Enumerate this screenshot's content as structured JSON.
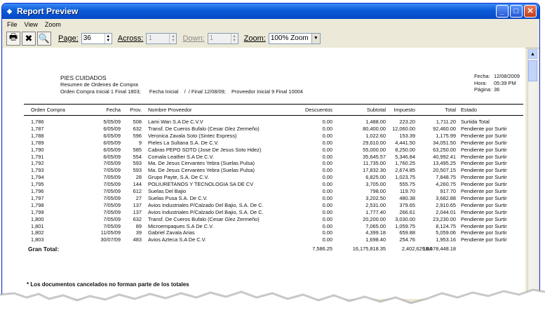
{
  "window": {
    "title": "Report Preview"
  },
  "menu": [
    "File",
    "View",
    "Zoom"
  ],
  "toolbar": {
    "page_label": "Page:",
    "page_value": "36",
    "across_label": "Across:",
    "across_value": "1",
    "down_label": "Down:",
    "down_value": "1",
    "zoom_label": "Zoom:",
    "zoom_value": "100% Zoom"
  },
  "report": {
    "company": "PIES CUIDADOS",
    "subtitle": "Resumen de Ordenes de Compra",
    "filters": "Orden Compra Inicial 1 Final 1803;      Fecha Inicial    /  / Final 12/08/09;    Proveedor Inicial 9 Final 10004",
    "meta": {
      "fecha_label": "Fecha:",
      "fecha": "12/08/2009",
      "hora_label": "Hora:",
      "hora": "05:39 PM",
      "pagina_label": "Página:",
      "pagina": "36"
    },
    "columns": [
      "Orden Compra",
      "Fecha",
      "Prov.",
      "Nombre Proveedor",
      "Descuentos",
      "Subtotal",
      "Impuesto",
      "Total",
      "Estado"
    ],
    "rows": [
      [
        "1,786",
        "5/05/09",
        "508",
        "Lami Wan S.A De C.V.V",
        "0.00",
        "1,488.00",
        "223.20",
        "1,711.20",
        "Surtida Total"
      ],
      [
        "1,787",
        "6/05/09",
        "632",
        "Transf. De Cueros Bufalo (Cesar Glez Zermeño)",
        "0.00",
        "80,400.00",
        "12,060.00",
        "92,460.00",
        "Pendiente por Surtir"
      ],
      [
        "1,788",
        "6/05/09",
        "596",
        "Veronica Zavala Soto  (Sintec Express)",
        "0.00",
        "1,022.60",
        "153.39",
        "1,175.99",
        "Pendiente por Surtir"
      ],
      [
        "1,789",
        "6/05/09",
        "9",
        "Pieles La Sultana S.A. De C.V.",
        "0.00",
        "29,610.00",
        "4,441.50",
        "34,051.50",
        "Pendiente por Surtir"
      ],
      [
        "1,790",
        "6/05/09",
        "585",
        "Cabras PEPO SOTO (Jose De Jesus Soto Hdez)",
        "0.00",
        "55,000.00",
        "8,250.00",
        "63,250.00",
        "Pendiente por Surtir"
      ],
      [
        "1,791",
        "6/05/09",
        "554",
        "Cornala Leather S.A De C.V.",
        "0.00",
        "35,645.57",
        "5,346.84",
        "40,992.41",
        "Pendiente por Surtir"
      ],
      [
        "1,792",
        "7/05/09",
        "593",
        "Ma. De Jesus Cervantes Yebra (Suelas Pulsa)",
        "0.00",
        "11,735.00",
        "1,760.25",
        "13,495.25",
        "Pendiente por Surtir"
      ],
      [
        "1,793",
        "7/05/09",
        "593",
        "Ma. De Jesus Cervantes Yebra (Suelas Pulsa)",
        "0.00",
        "17,832.30",
        "2,674.85",
        "20,507.15",
        "Pendiente por Surtir"
      ],
      [
        "1,794",
        "7/05/09",
        "28",
        "Grupo Payte, S.A. De C.V.",
        "0.00",
        "6,825.00",
        "1,023.75",
        "7,848.75",
        "Pendiente por Surtir"
      ],
      [
        "1,795",
        "7/05/09",
        "144",
        "POLIURETANOS Y TECNOLOGIA SA DE CV",
        "0.00",
        "3,705.00",
        "555.75",
        "4,260.75",
        "Pendiente por Surtir"
      ],
      [
        "1,796",
        "7/05/09",
        "612",
        "Suelas Del Bajio",
        "0.00",
        "798.00",
        "119.70",
        "917.70",
        "Pendiente por Surtir"
      ],
      [
        "1,797",
        "7/05/09",
        "27",
        "Suelas Pusa S.A. De C.V.",
        "0.00",
        "3,202.50",
        "480.38",
        "3,682.88",
        "Pendiente por Surtir"
      ],
      [
        "1,798",
        "7/05/09",
        "137",
        "Avios Industriales P/Calzado Del Bajio, S.A. De C.",
        "0.00",
        "2,531.00",
        "379.65",
        "2,910.65",
        "Pendiente por Surtir"
      ],
      [
        "1,799",
        "7/05/09",
        "137",
        "Avios Industriales P/Calzado Del Bajio, S.A. De C.",
        "0.00",
        "1,777.40",
        "266.61",
        "2,044.01",
        "Pendiente por Surtir"
      ],
      [
        "1,800",
        "7/05/09",
        "632",
        "Transf. De Cueros Bufalo (Cesar Glez Zermeño)",
        "0.00",
        "20,200.00",
        "3,030.00",
        "23,230.00",
        "Pendiente por Surtir"
      ],
      [
        "1,801",
        "7/05/09",
        "89",
        "Microempaques S.A De C.V.",
        "0.00",
        "7,065.00",
        "1,059.75",
        "8,124.75",
        "Pendiente por Surtir"
      ],
      [
        "1,802",
        "11/05/09",
        "39",
        "Gabriel Zavala Arias",
        "0.00",
        "4,399.18",
        "659.88",
        "5,059.06",
        "Pendiente por Surtir"
      ],
      [
        "1,803",
        "30/07/09",
        "483",
        "Avios Azteca S.A De C.V.",
        "0.00",
        "1,698.40",
        "254.76",
        "1,953.16",
        "Pendiente por Surtir"
      ]
    ],
    "totals": {
      "label": "Gran Total:",
      "descuentos": "7,586.25",
      "subtotal": "16,175,818.35",
      "impuesto": "2,402,629.84",
      "total": "18,578,448.18"
    },
    "footnote": "* Los documentos cancelados no forman parte de los totales"
  },
  "icons": [
    "print-icon",
    "close-report-icon",
    "search-icon"
  ]
}
